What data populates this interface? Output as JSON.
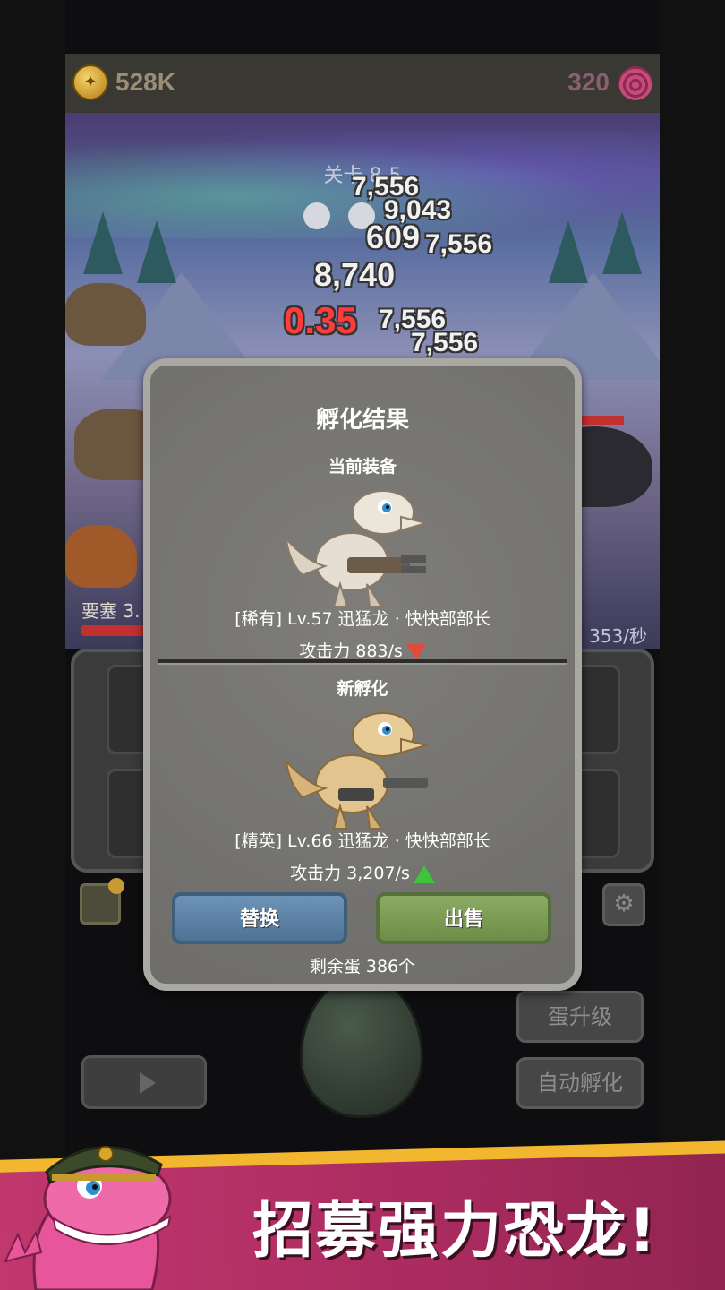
{
  "topbar": {
    "coins": "528K",
    "shells": "320"
  },
  "stage": {
    "level": "关卡 8-5",
    "damage_numbers": [
      "7,556",
      "9,043",
      "609",
      "7,556",
      "8,740",
      "0.35",
      "7,556",
      "7,556"
    ],
    "fortress_label": "要塞 3.",
    "dps_right": "353/秒"
  },
  "dialog": {
    "title": "孵化结果",
    "current": {
      "heading": "当前装备",
      "line": "[稀有] Lv.57 迅猛龙 · 快快部部长",
      "attack": "攻击力 883/s"
    },
    "new": {
      "heading": "新孵化",
      "line": "[精英] Lv.66 迅猛龙 · 快快部部长",
      "attack": "攻击力 3,207/s"
    },
    "replace_label": "替换",
    "sell_label": "出售",
    "remaining": "剩余蛋 386个"
  },
  "buttons": {
    "upgrade_egg": "蛋升级",
    "auto_hatch": "自动孵化"
  },
  "banner": {
    "text": "招募强力恐龙!"
  },
  "colors": {
    "accent_pink": "#c2386f",
    "banner_gold": "#f2b72f",
    "down": "#e24a3a",
    "up": "#3cc43a"
  }
}
